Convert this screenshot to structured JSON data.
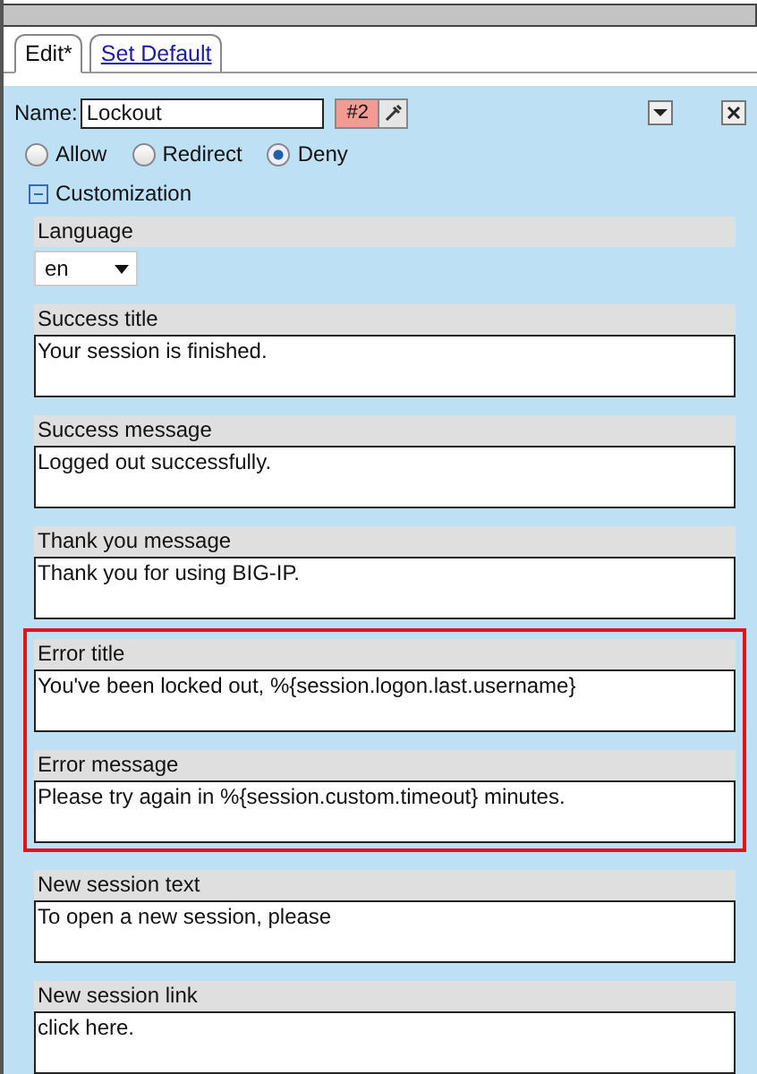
{
  "tabs": [
    {
      "label": "Edit*",
      "selected": true
    },
    {
      "label": "Set Default",
      "selected": false
    }
  ],
  "name_field": {
    "label": "Name:",
    "value": "Lockout",
    "badge": "#2"
  },
  "action": [
    {
      "label": "Allow",
      "selected": false
    },
    {
      "label": "Redirect",
      "selected": false
    },
    {
      "label": "Deny",
      "selected": true
    }
  ],
  "customization": {
    "label": "Customization",
    "expanded": true,
    "language": {
      "label": "Language",
      "value": "en"
    },
    "fields": [
      {
        "label": "Success title",
        "value": "Your session is finished.",
        "highlighted": false
      },
      {
        "label": "Success message",
        "value": "Logged out successfully.",
        "highlighted": false
      },
      {
        "label": "Thank you message",
        "value": "Thank you for using BIG-IP.",
        "highlighted": false
      },
      {
        "label": "Error title",
        "value": "You've been locked out, %{session.logon.last.username}",
        "highlighted": true
      },
      {
        "label": "Error message",
        "value": "Please try again in %{session.custom.timeout} minutes.",
        "highlighted": true
      },
      {
        "label": "New session text",
        "value": "To open a new session, please",
        "highlighted": false
      },
      {
        "label": "New session link",
        "value": "click here.",
        "highlighted": false
      }
    ]
  }
}
